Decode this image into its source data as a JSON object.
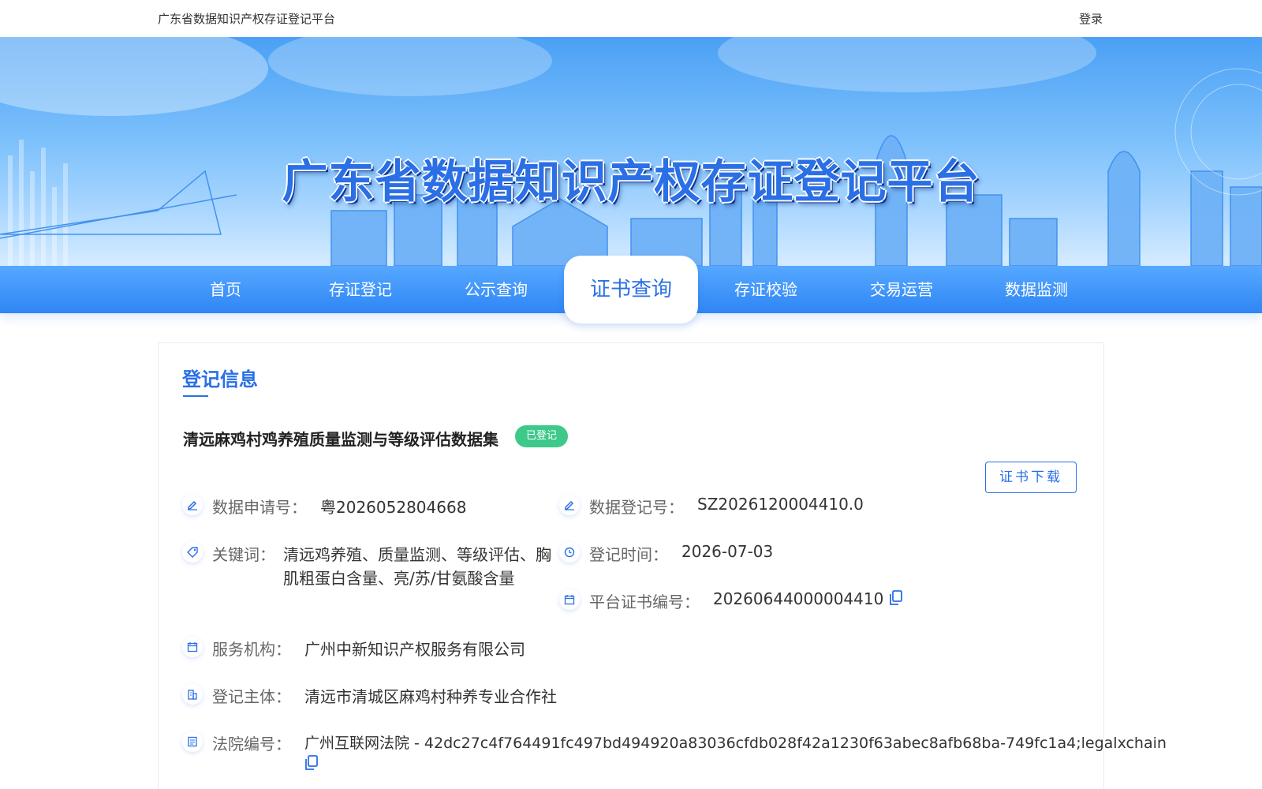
{
  "topbar": {
    "site_name": "广东省数据知识产权存证登记平台",
    "login": "登录"
  },
  "banner": {
    "title": "广东省数据知识产权存证登记平台"
  },
  "nav": {
    "items": [
      {
        "label": "首页"
      },
      {
        "label": "存证登记"
      },
      {
        "label": "公示查询"
      },
      {
        "label": "证书查询",
        "active": true
      },
      {
        "label": "存证校验"
      },
      {
        "label": "交易运营"
      },
      {
        "label": "数据监测"
      }
    ]
  },
  "record": {
    "section_title": "登记信息",
    "name": "清远麻鸡村鸡养殖质量监测与等级评估数据集",
    "status": "已登记",
    "download_label": "证书下载",
    "fields": {
      "application_no": {
        "label": "数据申请号：",
        "value": "粤2026052804668"
      },
      "registration_no": {
        "label": "数据登记号：",
        "value": "SZ2026120004410.0"
      },
      "keywords": {
        "label": "关键词：",
        "value_line1": "清远鸡养殖、质量监测、等级评估、胸",
        "value_line2": "肌粗蛋白含量、亮/苏/甘氨酸含量"
      },
      "registration_time": {
        "label": "登记时间：",
        "value": "2026-07-03"
      },
      "certificate_no": {
        "label": "平台证书编号：",
        "value": "20260644000004410"
      },
      "service_org": {
        "label": "服务机构：",
        "value": "广州中新知识产权服务有限公司"
      },
      "registrant": {
        "label": "登记主体：",
        "value": "清远市清城区麻鸡村种养专业合作社"
      },
      "court_no": {
        "label": "法院编号：",
        "value": "广州互联网法院 - 42dc27c4f764491fc497bd494920a83036cfdb028f42a1230f63abec8afb68ba-749fc1a4;legalxchain"
      }
    }
  },
  "colors": {
    "primary": "#2a6fe6",
    "status_green": "#3ec98b",
    "nav_blue": "#2f86f5"
  }
}
